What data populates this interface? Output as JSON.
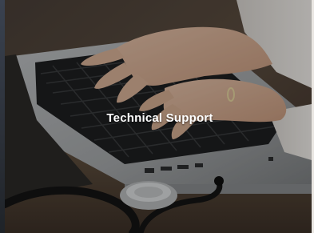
{
  "tile": {
    "caption": "Technical Support",
    "image_subject": "hands typing on laptop with stethoscope",
    "caption_color": "#ffffff"
  }
}
